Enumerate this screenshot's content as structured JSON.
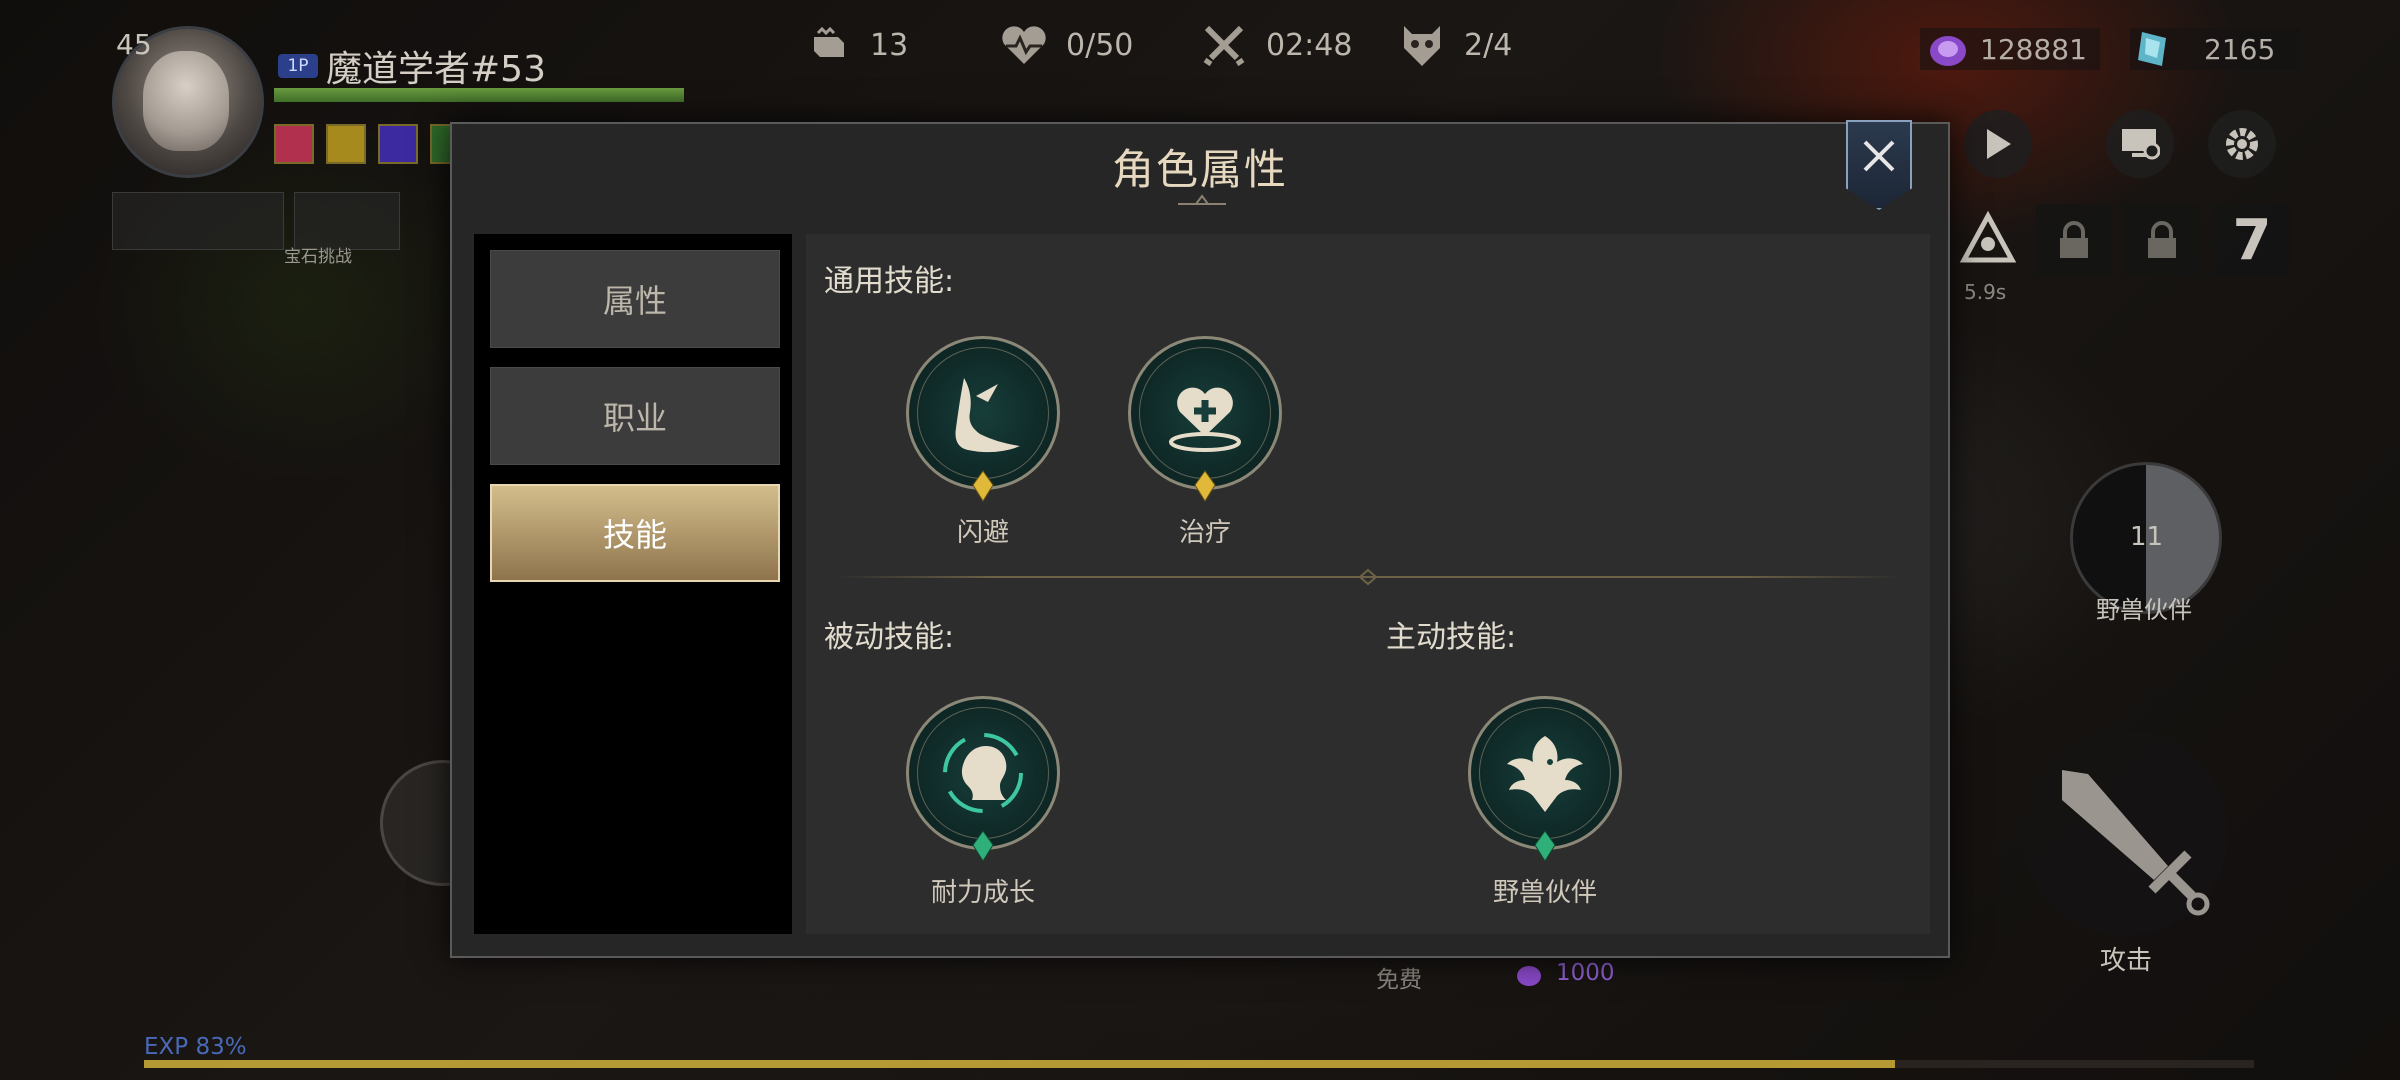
{
  "player": {
    "level": "45",
    "badge": "1P",
    "name": "魔道学者#53",
    "hp_fraction": 1.0,
    "slot_label": "宝石挑战"
  },
  "top_stats": [
    {
      "icon": "fist-icon",
      "value": "13"
    },
    {
      "icon": "heart-rate-icon",
      "value": "0/50"
    },
    {
      "icon": "crossed-swords-icon",
      "value": "02:48"
    },
    {
      "icon": "skull-mask-icon",
      "value": "2/4"
    }
  ],
  "currency": {
    "purple_gem": "128881",
    "blue_crystal": "2165"
  },
  "right_controls": {
    "cooldown": "5.9s",
    "slot_number": "7",
    "pet_count": "11",
    "pet_label": "野兽伙伴",
    "attack_label": "攻击"
  },
  "bottom": {
    "free_label": "免费",
    "cost": "1000",
    "exp_label": "EXP 83%",
    "exp_fraction": 0.83
  },
  "dialog": {
    "title": "角色属性",
    "tabs": [
      {
        "label": "属性",
        "active": false
      },
      {
        "label": "职业",
        "active": false
      },
      {
        "label": "技能",
        "active": true
      }
    ],
    "general_title": "通用技能:",
    "passive_title": "被动技能:",
    "active_title": "主动技能:",
    "general_skills": [
      {
        "name": "闪避",
        "icon": "dodge-foot-icon",
        "gem": "gold"
      },
      {
        "name": "治疗",
        "icon": "heal-heart-icon",
        "gem": "gold"
      }
    ],
    "passive_skills": [
      {
        "name": "耐力成长",
        "icon": "head-aura-icon",
        "gem": "green"
      }
    ],
    "active_skills": [
      {
        "name": "野兽伙伴",
        "icon": "eagle-icon",
        "gem": "green"
      }
    ]
  },
  "colors": {
    "accent_gold": "#d3bd8c",
    "hp_green": "#6a9a40",
    "exp_gold": "#b59a33",
    "skill_bg": "#173e3a",
    "cost_purple": "#8f5fd0"
  }
}
